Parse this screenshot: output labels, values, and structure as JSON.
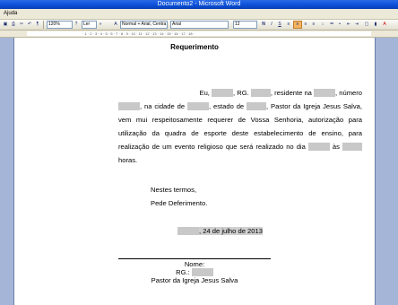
{
  "window": {
    "title": "Documento2 - Microsoft Word"
  },
  "menu": {
    "help": "Ajuda"
  },
  "toolbar": {
    "zoom": "120%",
    "layout_label": "Ler",
    "style": "Normal + Arial, Centra",
    "font": "Arial",
    "size": "12"
  },
  "document": {
    "heading": "Requerimento",
    "para": {
      "eu": "Eu,",
      "rg": ", RG.",
      "residente": ", residente na",
      "numero": ", número",
      "cidade": ", na cidade de",
      "estado": ", estado de",
      "pastor": ", Pastor da Igreja Jesus Salva,",
      "body": "vem mui respeitosamente requerer de Vossa Senhoria, autorização para utilização da quadra de esporte deste estabelecimento de ensino, para realização de um evento religioso que será realizado no dia",
      "as": "às",
      "horas": "horas."
    },
    "closing": {
      "line1": "Nestes termos,",
      "line2": "Pede Deferimento."
    },
    "date": ", 24 de julho de 2013",
    "signature": {
      "name": "Nome:",
      "rg": "RG.:",
      "role": "Pastor da Igreja Jesus Salva"
    }
  }
}
